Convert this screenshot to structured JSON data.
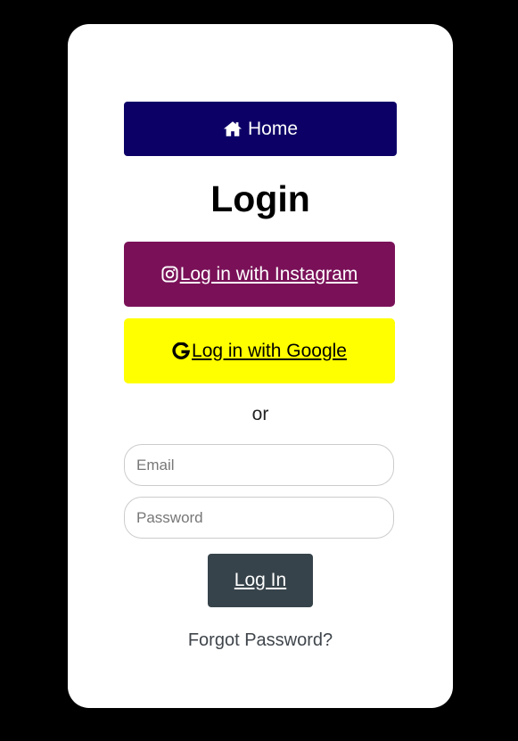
{
  "home_button": {
    "label": "Home",
    "icon": "home-icon",
    "color": "#0c0066"
  },
  "title": "Login",
  "social": {
    "instagram": {
      "label": "Log in with Instagram",
      "icon": "instagram-icon",
      "color": "#7a1158"
    },
    "google": {
      "label": "Log in with Google",
      "icon": "google-icon",
      "color": "#ffff00"
    }
  },
  "divider_text": "or",
  "form": {
    "email_placeholder": "Email",
    "email_value": "",
    "password_placeholder": "Password",
    "password_value": "",
    "submit_label": "Log In",
    "submit_color": "#37434a"
  },
  "forgot_password": "Forgot Password?"
}
